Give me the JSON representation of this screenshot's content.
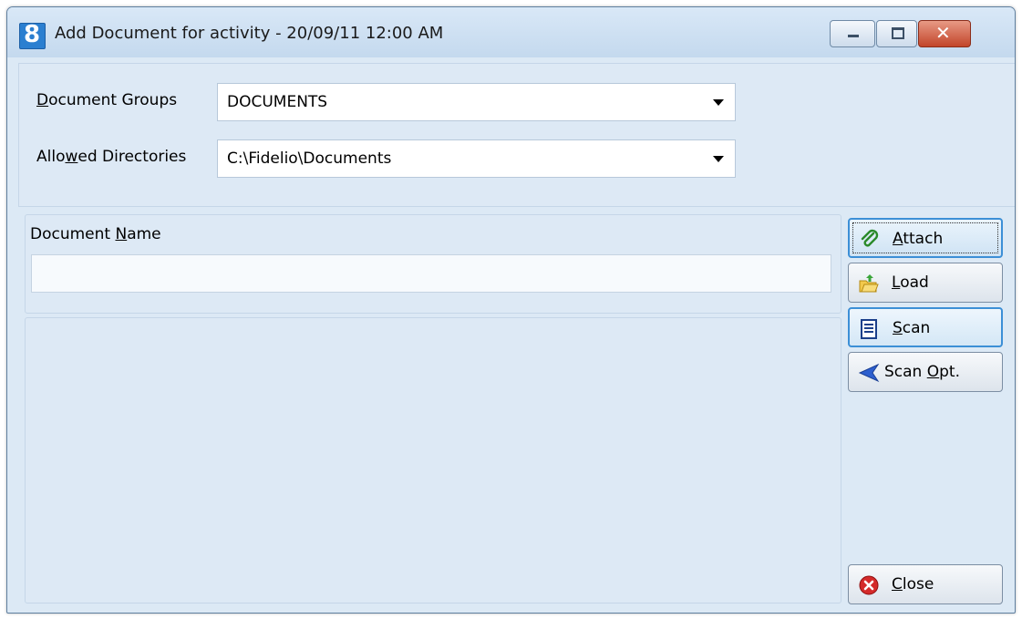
{
  "window": {
    "title": "Add Document for activity  - 20/09/11 12:00 AM",
    "app_icon_glyph": "8"
  },
  "title_controls": {
    "minimize": "minimize-icon",
    "maximize": "maximize-icon",
    "close": "close-icon"
  },
  "document_groups": {
    "label_pre": "D",
    "label_rest": "ocument Groups",
    "value": "DOCUMENTS"
  },
  "allowed_directories": {
    "label_pre": "Allo",
    "label_u": "w",
    "label_rest": "ed Directories",
    "value": "C:\\Fidelio\\Documents"
  },
  "document_name": {
    "label_pre": "Document ",
    "label_u": "N",
    "label_rest": "ame",
    "value": ""
  },
  "buttons": {
    "attach": {
      "u": "A",
      "rest": "ttach",
      "icon": "paperclip-icon"
    },
    "load": {
      "u": "L",
      "rest": "oad",
      "icon": "folder-open-icon"
    },
    "scan": {
      "u": "S",
      "rest": "can",
      "icon": "document-icon"
    },
    "scan_opt": {
      "pre": "Scan ",
      "u": "O",
      "rest": "pt.",
      "icon": "back-arrow-icon"
    },
    "close": {
      "u": "C",
      "rest": "lose",
      "icon": "close-circle-icon"
    }
  },
  "colors": {
    "window_bg": "#dce9f5",
    "close_button": "#c2452a",
    "focus_border": "#3c8fd6"
  }
}
